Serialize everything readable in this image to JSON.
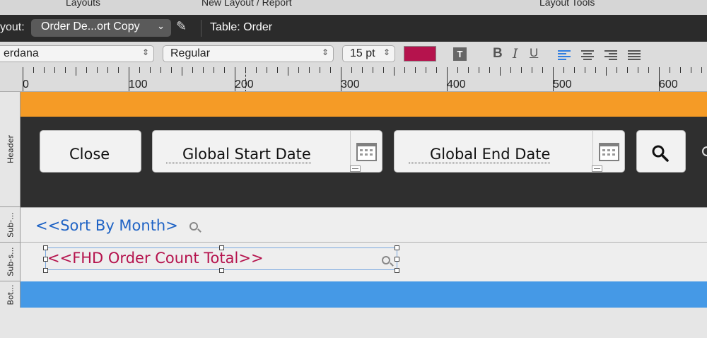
{
  "menu_row": {
    "layouts": "Layouts",
    "new_layout": "New Layout / Report",
    "layout_tools": "Layout Tools"
  },
  "layout_bar": {
    "label": "yout:",
    "layout_name": "Order De...ort Copy",
    "table": "Table: Order"
  },
  "format_bar": {
    "font": "erdana",
    "style": "Regular",
    "size": "15 pt",
    "text_color": "#b5134d",
    "bold": "B",
    "italic": "I",
    "underline": "U",
    "text_box": "T"
  },
  "ruler": {
    "labels": [
      "0",
      "100",
      "200",
      "300",
      "400",
      "500",
      "600"
    ]
  },
  "parts": {
    "header": "Header",
    "sub1": "Sub-...",
    "sub2": "Sub-s...",
    "bottom": "Bot..."
  },
  "header": {
    "close_label": "Close",
    "start_date_label": "Global Start Date",
    "end_date_label": "Global End Date"
  },
  "fields": {
    "sort_by_month": "<<Sort By Month>",
    "order_count_total": "<<FHD Order Count Total>>"
  },
  "colors": {
    "orange_bar": "#f59b26",
    "header_bg": "#2f2f2f",
    "bottom_bar": "#4599e6",
    "sort_field": "#1f63c5",
    "count_field": "#b5134d",
    "align_active": "#2f7de0"
  },
  "icons": {
    "pencil": "pencil-icon",
    "calendar": "calendar-icon",
    "search": "search-icon",
    "field_search": "magnifier-icon"
  }
}
